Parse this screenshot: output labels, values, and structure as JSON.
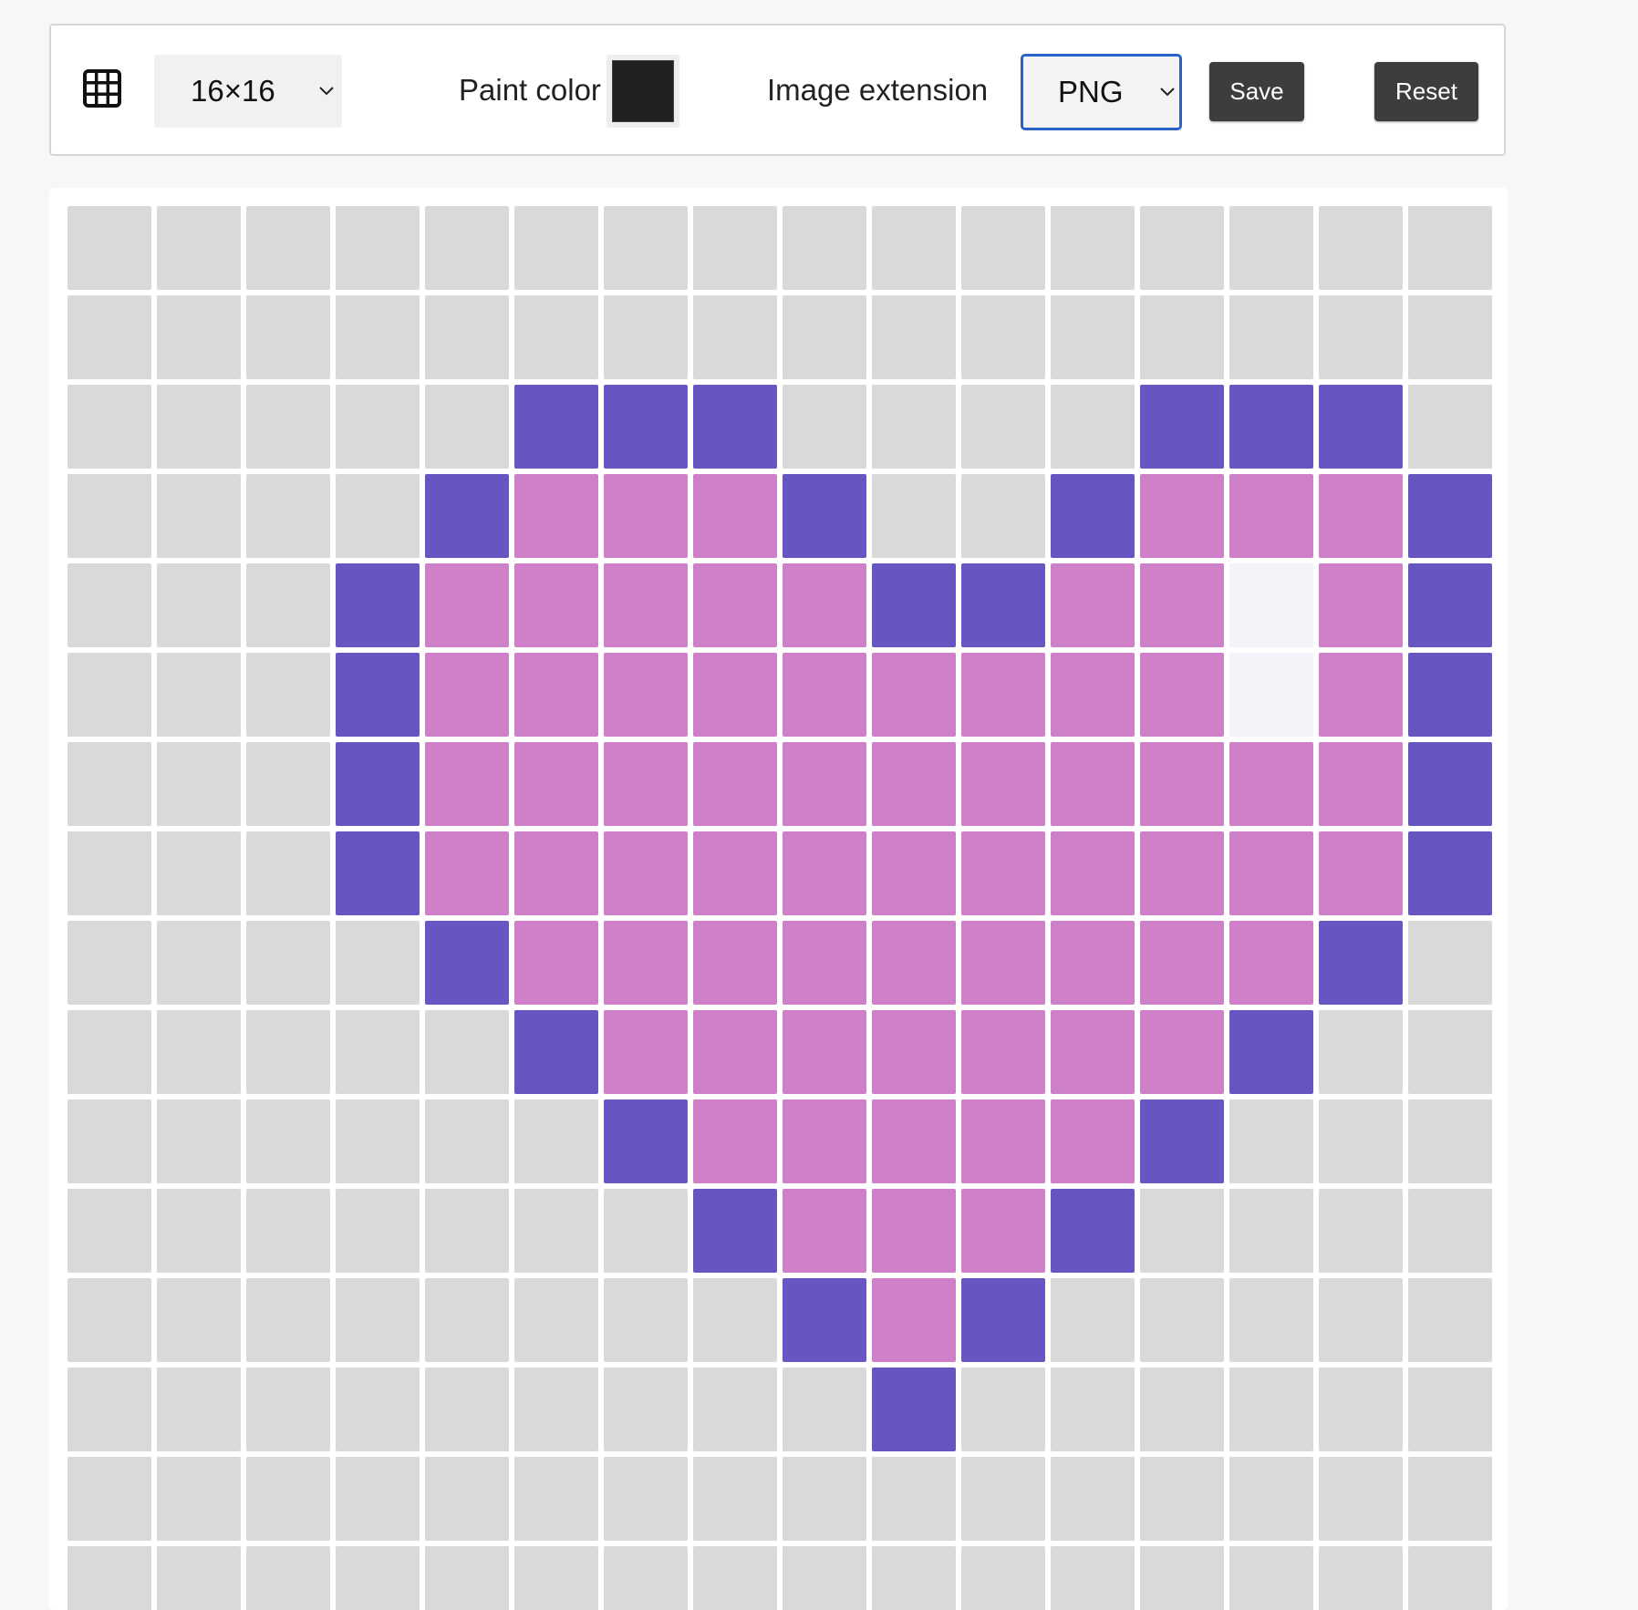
{
  "toolbar": {
    "grid_icon": "grid-icon",
    "size_value": "16×16",
    "paint_color_label": "Paint color",
    "paint_color": "#202021",
    "image_extension_label": "Image extension",
    "extension_value": "PNG",
    "save_label": "Save",
    "reset_label": "Reset"
  },
  "canvas": {
    "rows": 16,
    "cols": 16,
    "palette": {
      "E": "#d9d9d9",
      "D": "#6556c2",
      "P": "#cd7fc8",
      "W": "#f4f3f9"
    },
    "grid": [
      "EEEEEEEEEEEEEEEE",
      "EEEEEEEEEEEEEEEE",
      "EEEEEDDDEEEEDDDE",
      "EEEEDPPPDEEDPPPD",
      "EEEDPPPPPDDPPWPD",
      "EEEDPPPPPPPPPWPD",
      "EEEDPPPPPPPPPPPD",
      "EEEDPPPPPPPPPPPD",
      "EEEEDPPPPPPPPPDE",
      "EEEEEDPPPPPPPDEE",
      "EEEEEEDPPPPPDEEE",
      "EEEEEEEDPPPDEEEE",
      "EEEEEEEEDPDEEEEE",
      "EEEEEEEEEDEEEEEE",
      "EEEEEEEEEEEEEEEE",
      "EEEEEEEEEEEEEEEE"
    ]
  }
}
